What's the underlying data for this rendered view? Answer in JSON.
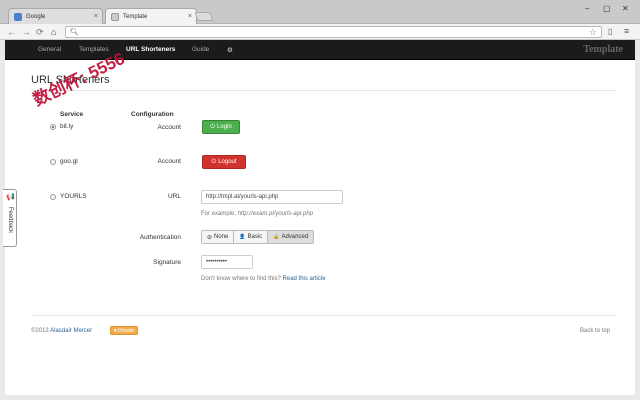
{
  "browser": {
    "tabs": [
      {
        "title": "Google",
        "close": "×"
      },
      {
        "title": "Template",
        "close": "×"
      }
    ],
    "window_controls": {
      "minimize": "–",
      "maximize": "▢",
      "close": "✕"
    },
    "nav": {
      "back": "←",
      "forward": "→",
      "reload": "⟳",
      "home": "⌂"
    },
    "address": "",
    "star": "☆",
    "menu": "≡"
  },
  "navbar": {
    "items": [
      "General",
      "Templates",
      "URL Shorteners",
      "Guide",
      "⚙"
    ],
    "active": "URL Shorteners",
    "brand": "Template"
  },
  "page": {
    "title": "URL Shorteners",
    "headers": {
      "service": "Service",
      "configuration": "Configuration"
    },
    "services": [
      {
        "name": "bit.ly",
        "checked": true,
        "config_label": "Account",
        "button": "Login",
        "button_icon": "⏻"
      },
      {
        "name": "goo.gl",
        "checked": false,
        "config_label": "Account",
        "button": "Logout",
        "button_icon": "⏻"
      },
      {
        "name": "YOURLS",
        "checked": false
      }
    ],
    "yourls": {
      "url_label": "URL",
      "url_value": "http://tmpl.at/yourls-api.php",
      "url_help_prefix": "For example;",
      "url_help_example": "http://exam.pl/yourls-api.php",
      "auth_label": "Authentication",
      "auth_options": [
        {
          "icon": "⊘",
          "label": "None"
        },
        {
          "icon": "👤",
          "label": "Basic"
        },
        {
          "icon": "🔒",
          "label": "Advanced"
        }
      ],
      "auth_selected": "Advanced",
      "signature_label": "Signature",
      "signature_value": "••••••••••",
      "signature_help": "Don't know where to find this?",
      "signature_help_link": "Read this article"
    }
  },
  "footer": {
    "copyright": "©2013",
    "author": "Alasdair Mercer",
    "donate": "Donate",
    "donate_icon": "♥",
    "back_to_top": "Back to top"
  },
  "feedback": {
    "label": "Feedback",
    "icon": "📢"
  },
  "watermark": "数创杯: 5556",
  "colors": {
    "navbar": "#1b1b1b",
    "login": "#4cae4c",
    "logout": "#d2322d",
    "donate": "#f0ad4e",
    "link": "#2a6496"
  }
}
